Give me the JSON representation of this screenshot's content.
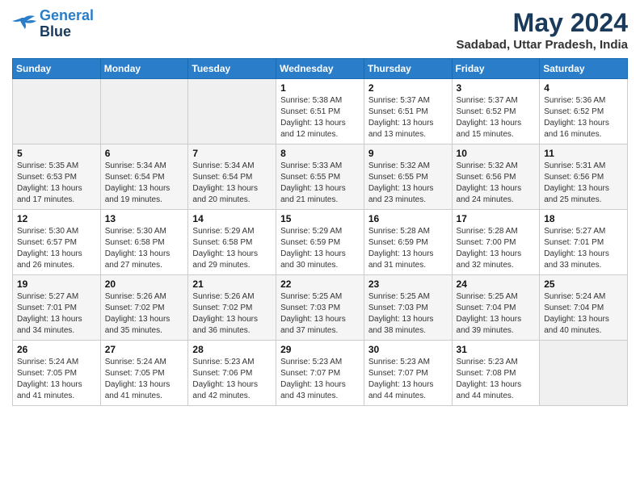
{
  "header": {
    "logo_line1": "General",
    "logo_line2": "Blue",
    "month_year": "May 2024",
    "location": "Sadabad, Uttar Pradesh, India"
  },
  "days_of_week": [
    "Sunday",
    "Monday",
    "Tuesday",
    "Wednesday",
    "Thursday",
    "Friday",
    "Saturday"
  ],
  "weeks": [
    [
      {
        "num": "",
        "content": ""
      },
      {
        "num": "",
        "content": ""
      },
      {
        "num": "",
        "content": ""
      },
      {
        "num": "1",
        "content": "Sunrise: 5:38 AM\nSunset: 6:51 PM\nDaylight: 13 hours\nand 12 minutes."
      },
      {
        "num": "2",
        "content": "Sunrise: 5:37 AM\nSunset: 6:51 PM\nDaylight: 13 hours\nand 13 minutes."
      },
      {
        "num": "3",
        "content": "Sunrise: 5:37 AM\nSunset: 6:52 PM\nDaylight: 13 hours\nand 15 minutes."
      },
      {
        "num": "4",
        "content": "Sunrise: 5:36 AM\nSunset: 6:52 PM\nDaylight: 13 hours\nand 16 minutes."
      }
    ],
    [
      {
        "num": "5",
        "content": "Sunrise: 5:35 AM\nSunset: 6:53 PM\nDaylight: 13 hours\nand 17 minutes."
      },
      {
        "num": "6",
        "content": "Sunrise: 5:34 AM\nSunset: 6:54 PM\nDaylight: 13 hours\nand 19 minutes."
      },
      {
        "num": "7",
        "content": "Sunrise: 5:34 AM\nSunset: 6:54 PM\nDaylight: 13 hours\nand 20 minutes."
      },
      {
        "num": "8",
        "content": "Sunrise: 5:33 AM\nSunset: 6:55 PM\nDaylight: 13 hours\nand 21 minutes."
      },
      {
        "num": "9",
        "content": "Sunrise: 5:32 AM\nSunset: 6:55 PM\nDaylight: 13 hours\nand 23 minutes."
      },
      {
        "num": "10",
        "content": "Sunrise: 5:32 AM\nSunset: 6:56 PM\nDaylight: 13 hours\nand 24 minutes."
      },
      {
        "num": "11",
        "content": "Sunrise: 5:31 AM\nSunset: 6:56 PM\nDaylight: 13 hours\nand 25 minutes."
      }
    ],
    [
      {
        "num": "12",
        "content": "Sunrise: 5:30 AM\nSunset: 6:57 PM\nDaylight: 13 hours\nand 26 minutes."
      },
      {
        "num": "13",
        "content": "Sunrise: 5:30 AM\nSunset: 6:58 PM\nDaylight: 13 hours\nand 27 minutes."
      },
      {
        "num": "14",
        "content": "Sunrise: 5:29 AM\nSunset: 6:58 PM\nDaylight: 13 hours\nand 29 minutes."
      },
      {
        "num": "15",
        "content": "Sunrise: 5:29 AM\nSunset: 6:59 PM\nDaylight: 13 hours\nand 30 minutes."
      },
      {
        "num": "16",
        "content": "Sunrise: 5:28 AM\nSunset: 6:59 PM\nDaylight: 13 hours\nand 31 minutes."
      },
      {
        "num": "17",
        "content": "Sunrise: 5:28 AM\nSunset: 7:00 PM\nDaylight: 13 hours\nand 32 minutes."
      },
      {
        "num": "18",
        "content": "Sunrise: 5:27 AM\nSunset: 7:01 PM\nDaylight: 13 hours\nand 33 minutes."
      }
    ],
    [
      {
        "num": "19",
        "content": "Sunrise: 5:27 AM\nSunset: 7:01 PM\nDaylight: 13 hours\nand 34 minutes."
      },
      {
        "num": "20",
        "content": "Sunrise: 5:26 AM\nSunset: 7:02 PM\nDaylight: 13 hours\nand 35 minutes."
      },
      {
        "num": "21",
        "content": "Sunrise: 5:26 AM\nSunset: 7:02 PM\nDaylight: 13 hours\nand 36 minutes."
      },
      {
        "num": "22",
        "content": "Sunrise: 5:25 AM\nSunset: 7:03 PM\nDaylight: 13 hours\nand 37 minutes."
      },
      {
        "num": "23",
        "content": "Sunrise: 5:25 AM\nSunset: 7:03 PM\nDaylight: 13 hours\nand 38 minutes."
      },
      {
        "num": "24",
        "content": "Sunrise: 5:25 AM\nSunset: 7:04 PM\nDaylight: 13 hours\nand 39 minutes."
      },
      {
        "num": "25",
        "content": "Sunrise: 5:24 AM\nSunset: 7:04 PM\nDaylight: 13 hours\nand 40 minutes."
      }
    ],
    [
      {
        "num": "26",
        "content": "Sunrise: 5:24 AM\nSunset: 7:05 PM\nDaylight: 13 hours\nand 41 minutes."
      },
      {
        "num": "27",
        "content": "Sunrise: 5:24 AM\nSunset: 7:05 PM\nDaylight: 13 hours\nand 41 minutes."
      },
      {
        "num": "28",
        "content": "Sunrise: 5:23 AM\nSunset: 7:06 PM\nDaylight: 13 hours\nand 42 minutes."
      },
      {
        "num": "29",
        "content": "Sunrise: 5:23 AM\nSunset: 7:07 PM\nDaylight: 13 hours\nand 43 minutes."
      },
      {
        "num": "30",
        "content": "Sunrise: 5:23 AM\nSunset: 7:07 PM\nDaylight: 13 hours\nand 44 minutes."
      },
      {
        "num": "31",
        "content": "Sunrise: 5:23 AM\nSunset: 7:08 PM\nDaylight: 13 hours\nand 44 minutes."
      },
      {
        "num": "",
        "content": ""
      }
    ]
  ]
}
